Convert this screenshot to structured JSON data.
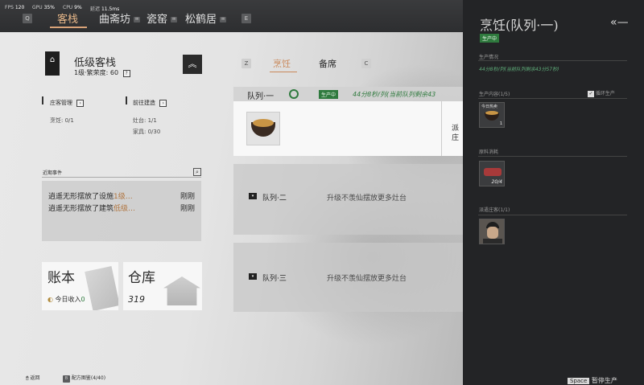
{
  "perf": {
    "fps_label": "FPS",
    "fps": "120",
    "gpu_label": "GPU",
    "gpu": "35%",
    "cpu_label": "CPU",
    "cpu": "9%",
    "latency_label": "延迟",
    "latency": "11.5ms"
  },
  "nav": {
    "key_left": "Q",
    "tabs": [
      "客栈",
      "曲斋坊",
      "瓷窑",
      "松鹤居"
    ],
    "key_right": "E"
  },
  "inn": {
    "name": "低级客栈",
    "level_text": "1级·繁荣度: 60",
    "help": "?",
    "manage_title": "庄客管理",
    "manage_cook": "烹饪: 0/1",
    "build_title": "前往建造",
    "build_stove": "灶台: 1/1",
    "build_furniture": "家具: 0/30"
  },
  "events": {
    "title": "近期事件",
    "items": [
      {
        "prefix": "逍遥无形摆放了设施",
        "highlight": "1级…",
        "time": "刚刚"
      },
      {
        "prefix": "逍遥无形摆放了建筑",
        "highlight": "低级…",
        "time": "刚刚"
      }
    ]
  },
  "ledger": {
    "title": "账本",
    "income_label": "今日收入",
    "income_value": "0"
  },
  "warehouse": {
    "title": "仓库",
    "value": "319"
  },
  "bottom": {
    "back_label": "返回",
    "recipes_label": "配方图鉴(4/40)"
  },
  "tabs": {
    "key_left": "Z",
    "cook": "烹饪",
    "prepare": "备席",
    "key_right": "C"
  },
  "queue1": {
    "title": "队列·一",
    "status": "生产中",
    "time_text": "44分8秒/列(当前队列剩余43",
    "dispatch_line1": "派",
    "dispatch_line2": "庄"
  },
  "queue2": {
    "title": "队列·二",
    "desc": "升级不羡仙摆放更多灶台"
  },
  "queue3": {
    "title": "队列·三",
    "desc": "升级不羡仙摆放更多灶台"
  },
  "panel": {
    "title": "烹饪(队列·一)",
    "status": "生产中",
    "production_title": "生产情况",
    "production_text": "44分8秒/列(当前队列剩余43分57秒)",
    "content_title": "生产内容(1/5)",
    "loop_label": "循环生产",
    "dish_label": "今日热卖",
    "dish_count": "1",
    "material_title": "原料消耗",
    "material_count": "20/4",
    "worker_title": "派遣庄客(1/1)",
    "space_key": "Space",
    "pause_label": "暂停生产"
  },
  "colors": {
    "accent": "#d9a378",
    "status_green": "#2f7a3e",
    "panel_bg": "#232426"
  }
}
